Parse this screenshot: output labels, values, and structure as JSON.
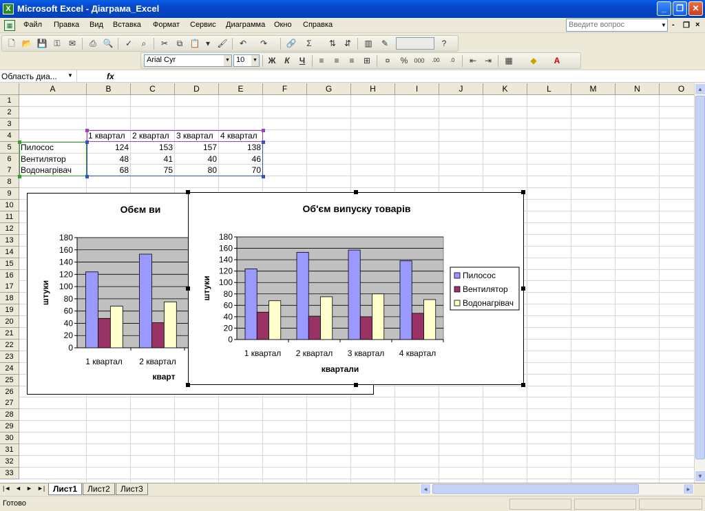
{
  "window": {
    "title": "Microsoft Excel - Діаграма_Excel",
    "buttons": [
      "_",
      "❐",
      "✕"
    ]
  },
  "menu": {
    "items": [
      "Файл",
      "Правка",
      "Вид",
      "Вставка",
      "Формат",
      "Сервис",
      "Диаграмма",
      "Окно",
      "Справка"
    ],
    "help_placeholder": "Введите вопрос",
    "mdi_buttons": [
      "-",
      "❐",
      "×"
    ]
  },
  "format_toolbar": {
    "font": "Arial Cyr",
    "size": "10",
    "bold": "Ж",
    "italic": "К",
    "underline": "Ч"
  },
  "formula_bar": {
    "name_box": "Область диа...",
    "fx": "fx",
    "value": ""
  },
  "sheet": {
    "columns": [
      "A",
      "B",
      "C",
      "D",
      "E",
      "F",
      "G",
      "H",
      "I",
      "J",
      "K",
      "L",
      "M",
      "N",
      "O"
    ],
    "rows": [
      "1",
      "2",
      "3",
      "4",
      "5",
      "6",
      "7",
      "8",
      "9",
      "10",
      "11",
      "12",
      "13",
      "14",
      "15",
      "16",
      "17",
      "18",
      "19",
      "20",
      "21",
      "22",
      "23",
      "24",
      "25",
      "26",
      "27",
      "28",
      "29",
      "30",
      "31",
      "32",
      "33"
    ],
    "headers": [
      "1 квартал",
      "2 квартал",
      "3 квартал",
      "4 квартал"
    ],
    "data": [
      {
        "name": "Пилосос",
        "values": [
          "124",
          "153",
          "157",
          "138"
        ]
      },
      {
        "name": "Вентилятор",
        "values": [
          "48",
          "41",
          "40",
          "46"
        ]
      },
      {
        "name": "Водонагрівач",
        "values": [
          "68",
          "75",
          "80",
          "70"
        ]
      }
    ]
  },
  "tabs": {
    "nav": [
      "|◄",
      "◄",
      "►",
      "►|"
    ],
    "sheets": [
      "Лист1",
      "Лист2",
      "Лист3"
    ],
    "active": "Лист1"
  },
  "status": {
    "text": "Готово"
  },
  "colors": {
    "series": [
      "#9999ff",
      "#993366",
      "#ffffcc"
    ],
    "plot_area": "#c0c0c0"
  },
  "chart_data": [
    {
      "type": "bar",
      "title": "Обєм ви",
      "xlabel": "кварт",
      "ylabel": "штуки",
      "categories": [
        "1 квартал",
        "2 квартал"
      ],
      "ylim": [
        0,
        180
      ],
      "yticks": [
        "0",
        "20",
        "40",
        "60",
        "80",
        "100",
        "120",
        "140",
        "160",
        "180"
      ],
      "series": [
        {
          "name": "Пилосос",
          "values": [
            124,
            153
          ]
        },
        {
          "name": "Вентилятор",
          "values": [
            48,
            41
          ]
        },
        {
          "name": "Водонагрівач",
          "values": [
            68,
            75
          ]
        }
      ],
      "legend": "hidden",
      "grid": true
    },
    {
      "type": "bar",
      "title": "Об'єм випуску товарів",
      "xlabel": "квартали",
      "ylabel": "штуки",
      "categories": [
        "1 квартал",
        "2 квартал",
        "3 квартал",
        "4 квартал"
      ],
      "ylim": [
        0,
        180
      ],
      "yticks": [
        "0",
        "20",
        "40",
        "60",
        "80",
        "100",
        "120",
        "140",
        "160",
        "180"
      ],
      "series": [
        {
          "name": "Пилосос",
          "values": [
            124,
            153,
            157,
            138
          ]
        },
        {
          "name": "Вентилятор",
          "values": [
            48,
            41,
            40,
            46
          ]
        },
        {
          "name": "Водонагрівач",
          "values": [
            68,
            75,
            80,
            70
          ]
        }
      ],
      "legend": "right",
      "grid": true
    }
  ]
}
